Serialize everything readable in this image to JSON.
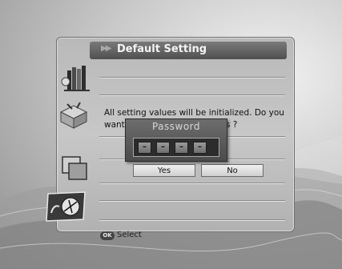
{
  "header": {
    "title": "Default Setting"
  },
  "dialog": {
    "message_line1": "All setting values will be initialized. Do you",
    "message_line2_start": "want",
    "message_line2_end": "s ?",
    "yes_label": "Yes",
    "no_label": "No"
  },
  "password": {
    "title": "Password",
    "digits": [
      "–",
      "–",
      "–",
      "–"
    ]
  },
  "footer": {
    "ok_key": "OK",
    "select_label": "Select"
  },
  "icons": [
    "library-icon",
    "gift-box-icon",
    "windows-icon",
    "satellite-dish-icon"
  ],
  "colors": {
    "panel": "#bdbdbd",
    "title_bar": "#5e5e5e",
    "popup": "#5a5a5a"
  }
}
